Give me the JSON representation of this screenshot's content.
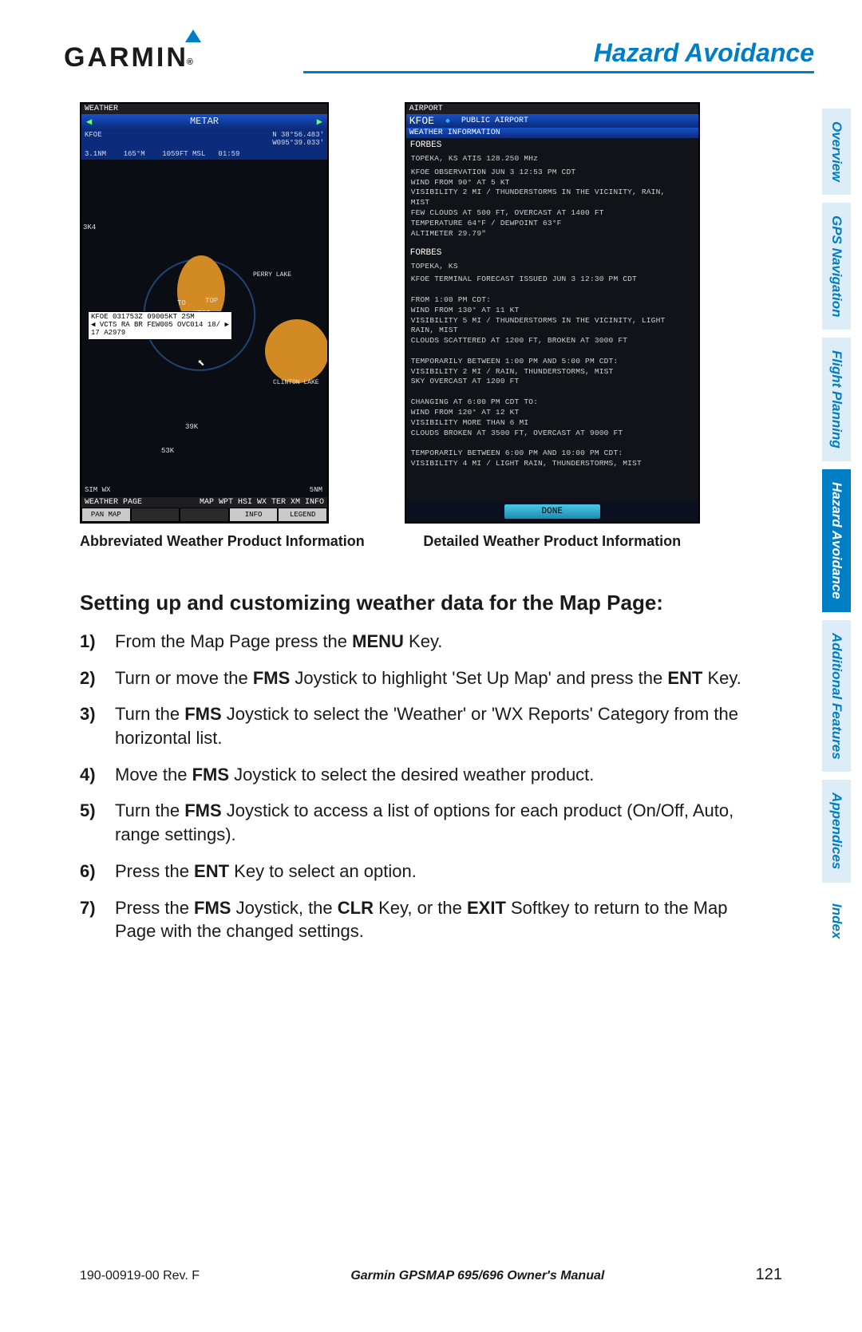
{
  "header": {
    "logo_text": "GARMIN",
    "section_title": "Hazard Avoidance"
  },
  "figure_a": {
    "top_bar": "WEATHER",
    "metar_label": "METAR",
    "row1_left": "KFOE",
    "row1_right_a": "N 38°56.483'",
    "row1_right_b": "W095°39.033'",
    "row2": "3.1NM    165°M    1059FT MSL   01:59",
    "tag_line1": "KFOE 031753Z 09005KT 2SM",
    "tag_line2": "VCTS RA BR FEW005 OVC014 18/",
    "tag_line3": "17 A2979",
    "label_perry": "PERRY LAKE",
    "label_clinton": "CLINTON LAKE",
    "label_ktop": "KTOP",
    "label_top": "TOP",
    "label_to": "TO",
    "label_3k4": "3K4",
    "label_39k": "39K",
    "label_53k": "53K",
    "sim": "SIM WX",
    "scale_label": "5NM",
    "bar_weather_page": "WEATHER PAGE",
    "bar_map": "MAP WPT HSI WX TER XM INFO",
    "sk_pan": "PAN MAP",
    "sk_info": "INFO",
    "sk_legend": "LEGEND",
    "caption": "Abbreviated Weather Product Information"
  },
  "figure_b": {
    "top_bar": "AIRPORT",
    "kfoe": "KFOE",
    "public": "PUBLIC AIRPORT",
    "wx_info": "WEATHER INFORMATION",
    "block1_h": "FORBES",
    "block1_s": "TOPEKA, KS   ATIS 128.250 MHz",
    "block1_t": "KFOE OBSERVATION JUN 3 12:53 PM CDT\nWIND FROM 90° AT 5 KT\nVISIBILITY 2 MI / THUNDERSTORMS IN THE VICINITY, RAIN,\nMIST\nFEW CLOUDS AT 500 FT, OVERCAST AT 1400 FT\nTEMPERATURE 64°F / DEWPOINT 63°F\nALTIMETER 29.79\"",
    "block2_h": "FORBES",
    "block2_s": "TOPEKA, KS",
    "block2_t": "KFOE TERMINAL FORECAST ISSUED JUN 3 12:30 PM CDT\n\nFROM 1:00 PM CDT:\nWIND FROM 130° AT 11 KT\nVISIBILITY 5 MI / THUNDERSTORMS IN THE VICINITY, LIGHT\nRAIN, MIST\nCLOUDS SCATTERED AT 1200 FT, BROKEN AT 3000 FT\n\nTEMPORARILY BETWEEN 1:00 PM AND 5:00 PM CDT:\nVISIBILITY 2 MI / RAIN, THUNDERSTORMS, MIST\nSKY OVERCAST AT 1200 FT\n\nCHANGING AT 6:00 PM CDT TO:\nWIND FROM 120° AT 12 KT\nVISIBILITY MORE THAN 6 MI\nCLOUDS BROKEN AT 3500 FT, OVERCAST AT 9000 FT\n\nTEMPORARILY BETWEEN 6:00 PM AND 10:00 PM CDT:\nVISIBILITY 4 MI / LIGHT RAIN, THUNDERSTORMS, MIST",
    "done": "DONE",
    "caption": "Detailed Weather Product Information"
  },
  "tabs": [
    "Overview",
    "GPS Navigation",
    "Flight Planning",
    "Hazard Avoidance",
    "Additional Features",
    "Appendices",
    "Index"
  ],
  "content": {
    "heading": "Setting up and customizing weather data for the Map Page:",
    "steps": [
      {
        "n": "1)",
        "t": "From the Map Page press the <b>MENU</b> Key."
      },
      {
        "n": "2)",
        "t": "Turn or move the <b>FMS</b> Joystick to highlight 'Set Up Map' and press the <b>ENT</b> Key."
      },
      {
        "n": "3)",
        "t": "Turn the <b>FMS</b> Joystick to select the 'Weather' or 'WX Reports' Category from the horizontal list."
      },
      {
        "n": "4)",
        "t": "Move the <b>FMS</b> Joystick to select the desired weather product."
      },
      {
        "n": "5)",
        "t": "Turn the <b>FMS</b> Joystick to access a list of options for each product (On/Off, Auto, range settings)."
      },
      {
        "n": "6)",
        "t": "Press the <b>ENT</b> Key to select an option."
      },
      {
        "n": "7)",
        "t": "Press the <b>FMS</b> Joystick, the <b>CLR</b> Key, or the <b>EXIT</b> Softkey to return to the Map Page with the changed settings."
      }
    ]
  },
  "footer": {
    "left": "190-00919-00  Rev. F",
    "mid": "Garmin GPSMAP 695/696 Owner's Manual",
    "page": "121"
  }
}
